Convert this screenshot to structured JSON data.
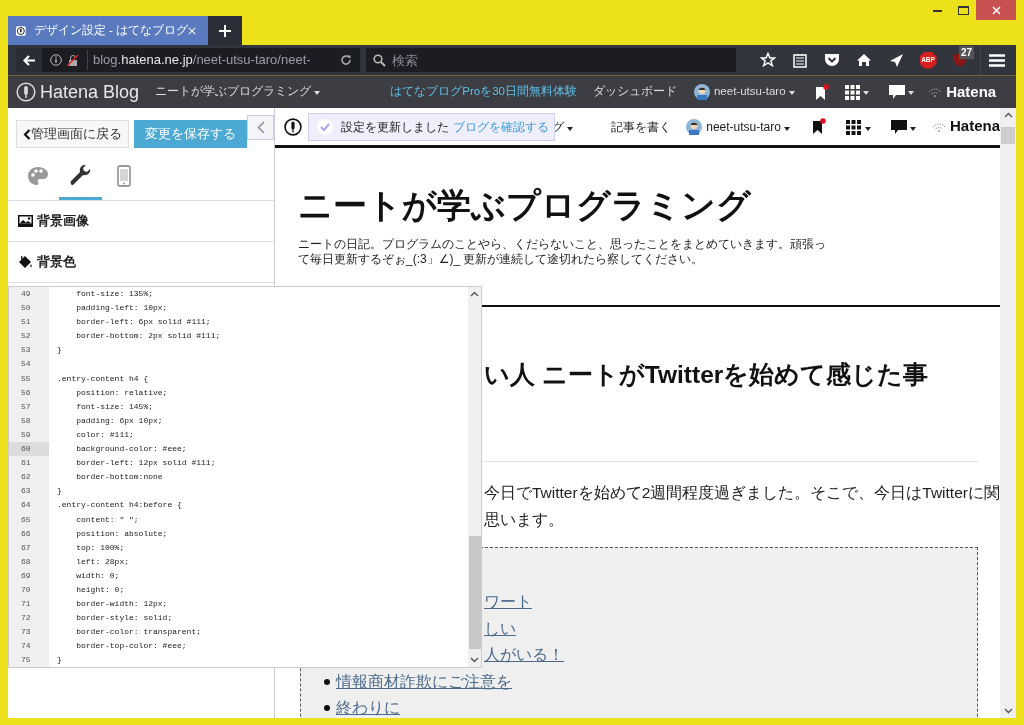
{
  "window": {
    "tab_title": "デザイン設定 - はてなブログ"
  },
  "toolbar": {
    "url": "blog.**hatena.ne.jp**/neet-utsu-taro/neet-",
    "search": {
      "placeholder": "検索"
    },
    "adblock_label": "ABP",
    "badge": "27"
  },
  "hatena_bar": {
    "logo": "Hatena Blog",
    "blog_menu": "ニートが学ぶプログラミング",
    "pro_link": "はてなブログProを30日間無料体験",
    "dashboard": "ダッシュボード",
    "user": "neet-utsu-taro",
    "brand": "Hatena"
  },
  "sidebar": {
    "back_button": "管理画面に戻る",
    "save_button": "変更を保存する",
    "tabs": [
      {
        "kind": "palette",
        "selected": false
      },
      {
        "kind": "wrench",
        "selected": true
      },
      {
        "kind": "phone",
        "selected": false
      }
    ],
    "sections": [
      {
        "kind": "image",
        "label": "背景画像"
      },
      {
        "kind": "fill",
        "label": "背景色"
      }
    ]
  },
  "editor": {
    "lines": [
      {
        "number": "49",
        "code": "    font-size: 135%;",
        "active": false
      },
      {
        "number": "50",
        "code": "    padding-left: 10px;",
        "active": false
      },
      {
        "number": "51",
        "code": "    border-left: 6px solid #111;",
        "active": false
      },
      {
        "number": "52",
        "code": "    border-bottom: 2px solid #111;",
        "active": false
      },
      {
        "number": "53",
        "code": "}",
        "active": false
      },
      {
        "number": "54",
        "active": false
      },
      {
        "number": "55",
        "code": ".entry-content h4 {",
        "active": false
      },
      {
        "number": "56",
        "code": "    position: relative;",
        "active": false
      },
      {
        "number": "57",
        "code": "    font-size: 145%;",
        "active": false
      },
      {
        "number": "58",
        "code": "    padding: 6px 10px;",
        "active": false
      },
      {
        "number": "59",
        "code": "    color: #111;",
        "active": false
      },
      {
        "number": "60",
        "code": "    background-color: #eee;",
        "active": true
      },
      {
        "number": "61",
        "code": "    border-left: 12px solid #111;",
        "active": false
      },
      {
        "number": "62",
        "code": "    border-bottom:none",
        "active": false
      },
      {
        "number": "63",
        "code": "}",
        "active": false
      },
      {
        "number": "64",
        "code": ".entry-content h4:before {",
        "active": false
      },
      {
        "number": "65",
        "code": "    content: \" \";",
        "active": false
      },
      {
        "number": "66",
        "code": "    position: absolute;",
        "active": false
      },
      {
        "number": "67",
        "code": "    top: 100%;",
        "active": false
      },
      {
        "number": "68",
        "code": "    left: 28px;",
        "active": false
      },
      {
        "number": "69",
        "code": "    width: 0;",
        "active": false
      },
      {
        "number": "70",
        "code": "    height: 0;",
        "active": false
      },
      {
        "number": "71",
        "code": "    border-width: 12px;",
        "active": false
      },
      {
        "number": "72",
        "code": "    border-style: solid;",
        "active": false
      },
      {
        "number": "73",
        "code": "    border-color: transparent;",
        "active": false
      },
      {
        "number": "74",
        "code": "    border-top-color: #eee;",
        "active": false
      },
      {
        "number": "75",
        "code": "}",
        "active": false
      }
    ]
  },
  "preview": {
    "notice": {
      "text": "設定を更新しました",
      "link": "ブログを確認する"
    },
    "menu_tail": "グ",
    "write_link": "記事を書く",
    "user": "neet-utsu-taro",
    "brand": "Hatena",
    "blog_title": "ニートが学ぶプログラミング",
    "description_lines": [
      "ニートの日記。プログラムのことやら、くだらないこと、思ったことをまとめていきます。頑張っ",
      "て毎日更新するぞぉ_(:3」∠)_ 更新が連続して途切れたら察してください。"
    ],
    "article_title": "い人 ニートがTwitterを始めて感じた事",
    "body_lines": [
      "今日でTwitterを始めて2週間程度過ぎました。そこで、今日はTwitterに関",
      "思います。"
    ],
    "toc_partial": [
      "ワート",
      "しい",
      "人がいる！"
    ],
    "toc_items": [
      "情報商材詐欺にご注意を",
      "終わりに"
    ]
  }
}
